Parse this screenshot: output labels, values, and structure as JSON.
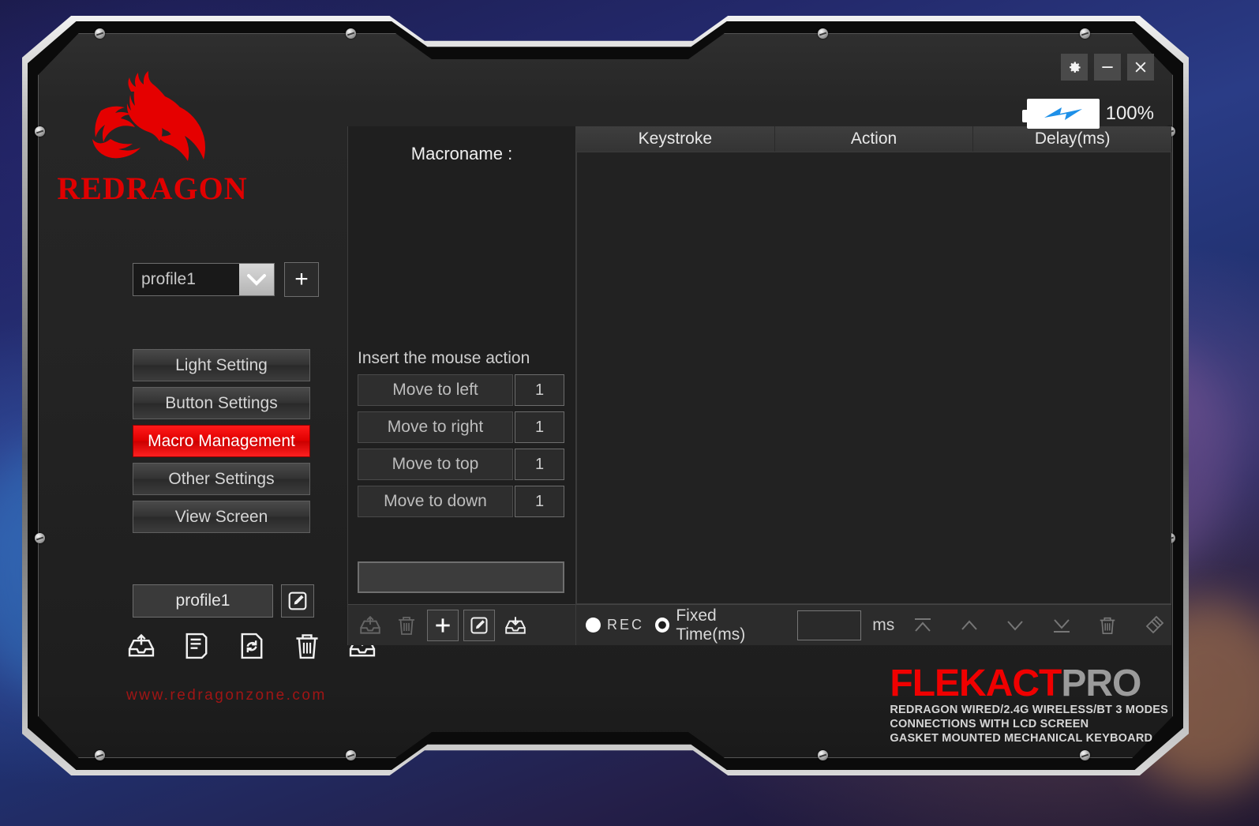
{
  "app": {
    "titlebar": {
      "settings_label": "gear-icon",
      "minimize_label": "minimize-icon",
      "close_label": "close-icon"
    },
    "battery": {
      "percent": "100%",
      "icon": "battery-charging-icon"
    }
  },
  "sidebar": {
    "logo": {
      "mark": "redragon-dragon-icon",
      "wordmark": "REDRAGON"
    },
    "profile_selector": {
      "value": "profile1",
      "chevron": "chevron-down-icon",
      "add_label": "+"
    },
    "nav_items": [
      {
        "label": "Light Setting",
        "active": false
      },
      {
        "label": "Button Settings",
        "active": false
      },
      {
        "label": "Macro Management",
        "active": true
      },
      {
        "label": "Other Settings",
        "active": false
      },
      {
        "label": "View Screen",
        "active": false
      }
    ],
    "profile_edit": {
      "name": "profile1",
      "edit_icon": "edit-pencil-icon"
    },
    "bottom_icons": [
      "export-tray-icon",
      "document-list-icon",
      "file-refresh-icon",
      "trash-icon",
      "import-tray-icon"
    ],
    "site_url": "www.redragonzone.com"
  },
  "center": {
    "macroname_label": "Macroname :",
    "insert_label": "Insert the mouse action",
    "mouse_actions": [
      {
        "label": "Move to left",
        "value": "1"
      },
      {
        "label": "Move to right",
        "value": "1"
      },
      {
        "label": "Move to top",
        "value": "1"
      },
      {
        "label": "Move to down",
        "value": "1"
      }
    ],
    "macro_name_input": {
      "value": "",
      "placeholder": ""
    },
    "toolbar_icons": [
      {
        "name": "export-macro-icon",
        "state": "disabled"
      },
      {
        "name": "delete-macro-icon",
        "state": "disabled"
      },
      {
        "name": "add-macro-icon",
        "state": "enabled"
      },
      {
        "name": "edit-macro-icon",
        "state": "enabled"
      },
      {
        "name": "import-macro-icon",
        "state": "enabled"
      }
    ]
  },
  "macro_table": {
    "columns": [
      "Keystroke",
      "Action",
      "Delay(ms)"
    ],
    "rows": []
  },
  "record_toolbar": {
    "rec_label": "REC",
    "rec_selected": false,
    "fixed_time_label": "Fixed Time(ms)",
    "fixed_time_selected": true,
    "fixed_time_value": "",
    "ms_label": "ms",
    "icons": [
      "move-to-top-icon",
      "move-up-icon",
      "move-down-icon",
      "move-to-bottom-icon",
      "delete-row-icon",
      "clear-all-icon"
    ]
  },
  "branding": {
    "title_red": "FLEKACT",
    "title_gray": "PRO",
    "lines": [
      "REDRAGON WIRED/2.4G WIRELESS/BT 3 MODES",
      "CONNECTIONS WITH LCD SCREEN",
      "GASKET MOUNTED MECHANICAL KEYBOARD"
    ]
  },
  "colors": {
    "accent_red": "#e00000",
    "brand_red": "#f00000",
    "battery_blue": "#1e90e8",
    "panel_bg": "#232323"
  }
}
